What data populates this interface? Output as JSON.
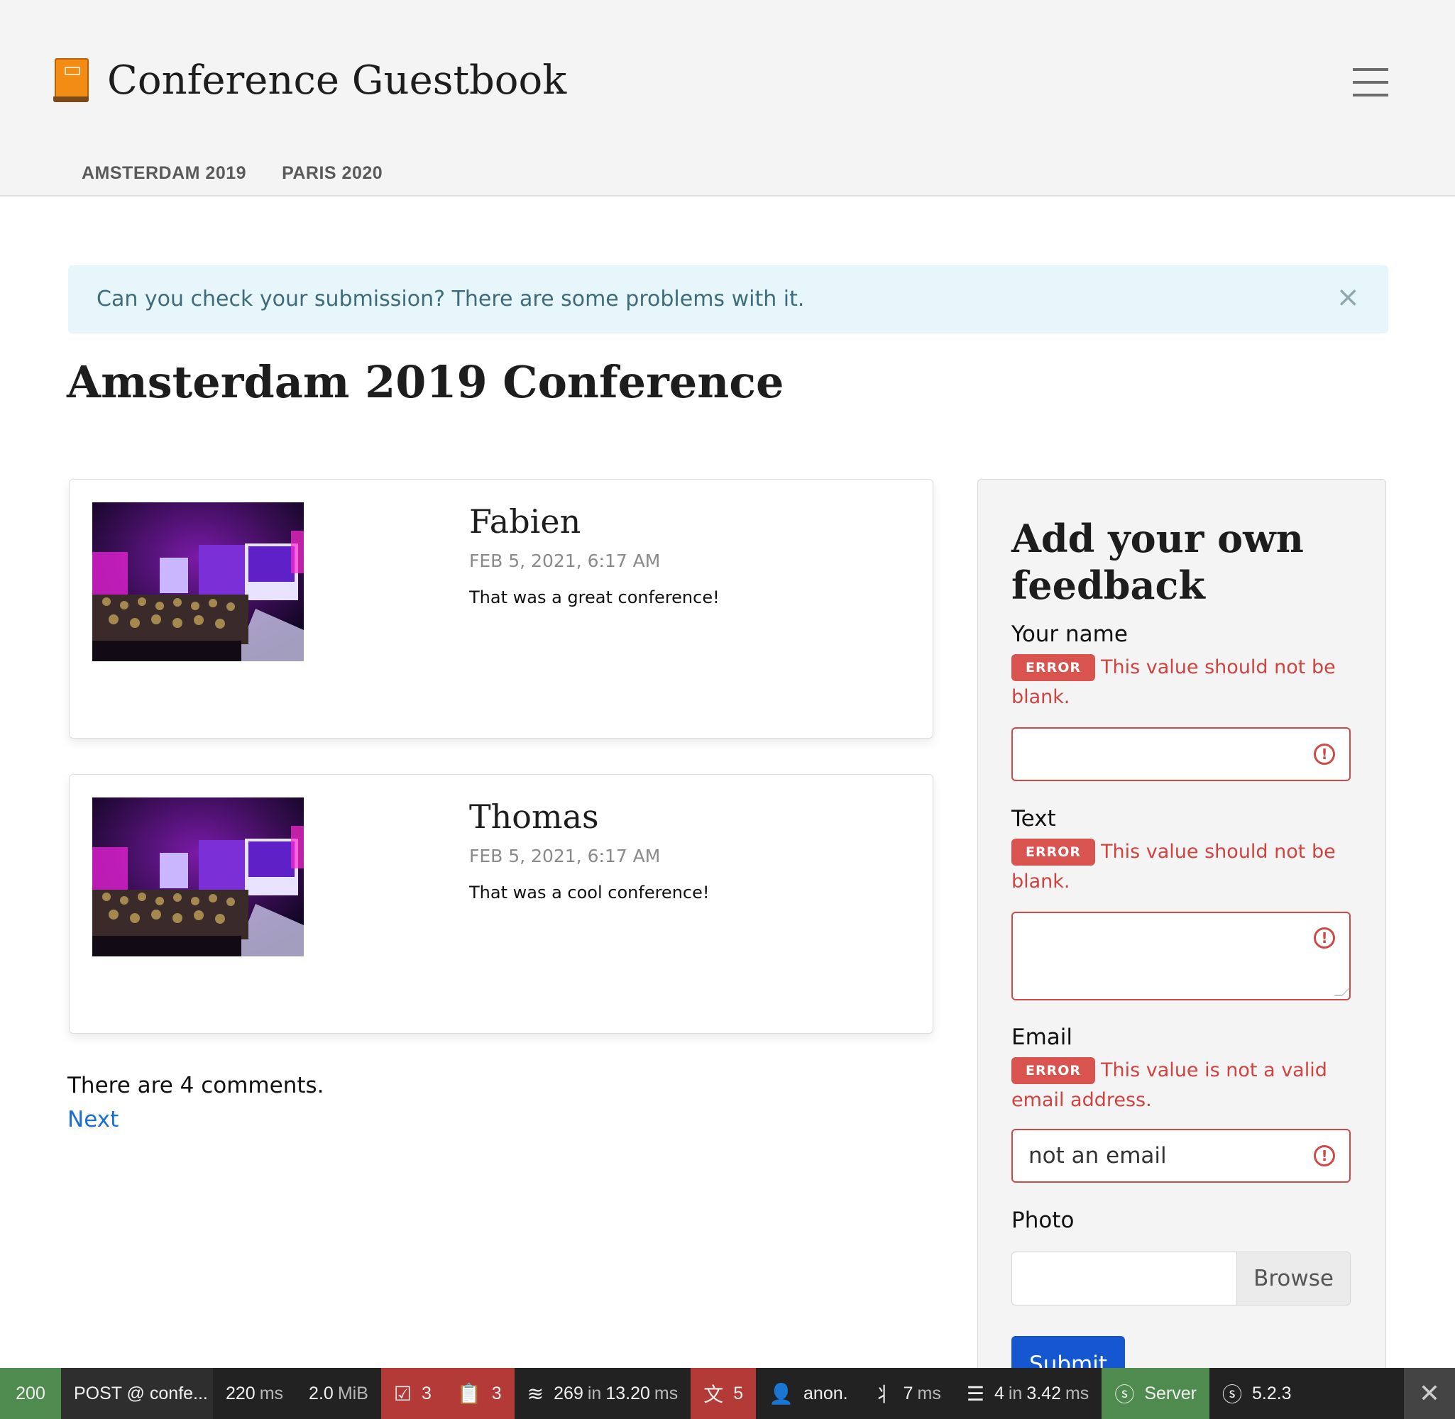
{
  "header": {
    "brand_title": "Conference Guestbook",
    "nav": [
      "AMSTERDAM 2019",
      "PARIS 2020"
    ]
  },
  "alert": {
    "message": "Can you check your submission? There are some problems with it.",
    "close": "×"
  },
  "page_title": "Amsterdam 2019 Conference",
  "comments": [
    {
      "author": "Fabien",
      "date": "FEB 5, 2021, 6:17 AM",
      "text": "That was a great conference!"
    },
    {
      "author": "Thomas",
      "date": "FEB 5, 2021, 6:17 AM",
      "text": "That was a cool conference!"
    }
  ],
  "comment_count_text": "There are 4 comments.",
  "next_label": "Next",
  "form": {
    "title": "Add your own feedback",
    "error_badge": "ERROR",
    "fields": {
      "name": {
        "label": "Your name",
        "error": "This value should not be blank.",
        "value": ""
      },
      "text": {
        "label": "Text",
        "error": "This value should not be blank.",
        "value": ""
      },
      "email": {
        "label": "Email",
        "error": "This value is not a valid email address.",
        "value": "not an email"
      },
      "photo": {
        "label": "Photo",
        "browse": "Browse"
      }
    },
    "submit": "Submit"
  },
  "toolbar": {
    "status": "200",
    "request": "POST @ confe...",
    "time": "220",
    "time_unit": "ms",
    "memory": "2.0",
    "memory_unit": "MiB",
    "forms_count": "3",
    "logs_count": "3",
    "db_count": "269",
    "db_in": "in",
    "db_time": "13.20",
    "db_unit": "ms",
    "translation_count": "5",
    "user": "anon.",
    "twig_time": "7",
    "twig_unit": "ms",
    "cache_count": "4",
    "cache_in": "in",
    "cache_time": "3.42",
    "cache_unit": "ms",
    "server_label": "Server",
    "version": "5.2.3",
    "close": "✕"
  }
}
